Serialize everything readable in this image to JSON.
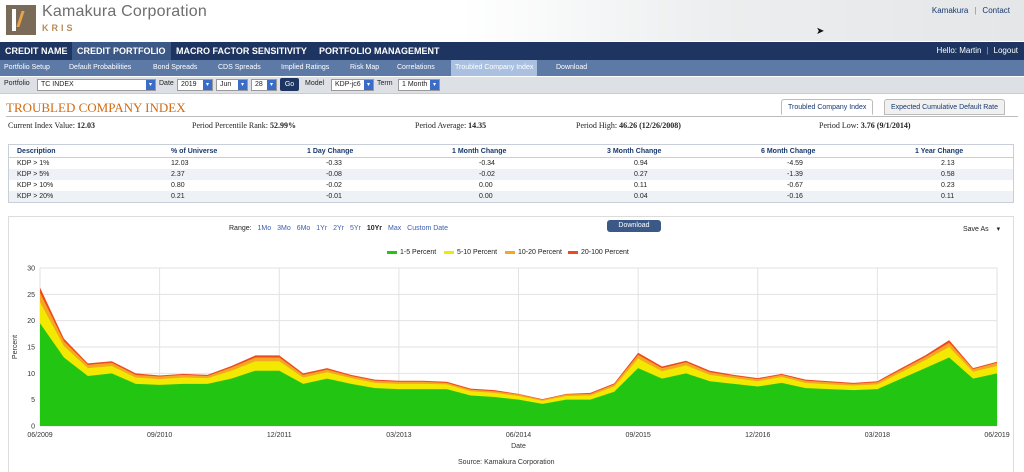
{
  "brand": {
    "name": "Kamakura Corporation",
    "sub": "KRIS"
  },
  "toplinks": [
    "Kamakura",
    "Contact"
  ],
  "mainnav": {
    "items": [
      "CREDIT NAME",
      "CREDIT PORTFOLIO",
      "MACRO FACTOR SENSITIVITY",
      "PORTFOLIO MANAGEMENT"
    ],
    "active": 1,
    "welcome": "Hello: Martin",
    "logout": "Logout"
  },
  "subnav": {
    "items": [
      "Portfolio Setup",
      "Default Probabilities",
      "Bond Spreads",
      "CDS Spreads",
      "Implied Ratings",
      "Risk Map",
      "Correlations",
      "Troubled Company Index",
      "Download"
    ],
    "active": 7
  },
  "filter": {
    "portfolio_label": "Portfolio",
    "portfolio": "TC INDEX",
    "date_label": "Date",
    "year": "2019",
    "month": "Jun",
    "day": "28",
    "go": "Go",
    "model_label": "Model",
    "model": "KDP-jc6",
    "term_label": "Term",
    "term": "1 Month"
  },
  "page": {
    "title": "TROUBLED COMPANY INDEX",
    "tabs": [
      "Troubled Company Index",
      "Expected Cumulative Default Rate"
    ]
  },
  "stats": {
    "current_label": "Current Index Value:",
    "current": "12.03",
    "rank_label": "Period Percentile Rank:",
    "rank": "52.99%",
    "avg_label": "Period Average:",
    "avg": "14.35",
    "high_label": "Period High:",
    "high": "46.26 (12/26/2008)",
    "low_label": "Period Low:",
    "low": "3.76 (9/1/2014)"
  },
  "table": {
    "headers": [
      "Description",
      "% of Universe",
      "1 Day Change",
      "1 Month Change",
      "3 Month Change",
      "6 Month Change",
      "1 Year Change"
    ],
    "rows": [
      [
        "KDP > 1%",
        "12.03",
        "-0.33",
        "-0.34",
        "0.94",
        "-4.59",
        "2.13"
      ],
      [
        "KDP > 5%",
        "2.37",
        "-0.08",
        "-0.02",
        "0.27",
        "-1.39",
        "0.58"
      ],
      [
        "KDP > 10%",
        "0.80",
        "-0.02",
        "0.00",
        "0.11",
        "-0.67",
        "0.23"
      ],
      [
        "KDP > 20%",
        "0.21",
        "-0.01",
        "0.00",
        "0.04",
        "-0.16",
        "0.11"
      ]
    ]
  },
  "controls": {
    "range_label": "Range:",
    "ranges": [
      "1Mo",
      "3Mo",
      "6Mo",
      "1Yr",
      "2Yr",
      "5Yr",
      "10Yr",
      "Max",
      "Custom Date"
    ],
    "range_selected": "10Yr",
    "download": "Download",
    "save_as": "Save As"
  },
  "colors": {
    "band1": "#22c511",
    "band2": "#f2e800",
    "band3": "#f5a623",
    "band4": "#ee4a1e"
  },
  "chart_data": {
    "type": "area",
    "stacked": true,
    "ylabel": "Percent",
    "xlabel": "Date",
    "ylim": [
      0,
      30
    ],
    "yticks": [
      0,
      5,
      10,
      15,
      20,
      25,
      30
    ],
    "xticks": [
      "06/2009",
      "09/2010",
      "12/2011",
      "03/2013",
      "06/2014",
      "09/2015",
      "12/2016",
      "03/2018",
      "06/2019"
    ],
    "grid": true,
    "legend_position": "top",
    "source": "Source: Kamakura Corporation",
    "x_start": "06/2009",
    "x_end": "06/2019",
    "x": [
      "2009-06",
      "2009-09",
      "2009-12",
      "2010-03",
      "2010-06",
      "2010-09",
      "2010-12",
      "2011-03",
      "2011-06",
      "2011-09",
      "2011-12",
      "2012-03",
      "2012-06",
      "2012-09",
      "2012-12",
      "2013-03",
      "2013-06",
      "2013-09",
      "2013-12",
      "2014-03",
      "2014-06",
      "2014-09",
      "2014-12",
      "2015-03",
      "2015-06",
      "2015-09",
      "2015-12",
      "2016-03",
      "2016-06",
      "2016-09",
      "2016-12",
      "2017-03",
      "2017-06",
      "2017-09",
      "2017-12",
      "2018-03",
      "2018-06",
      "2018-09",
      "2018-12",
      "2019-03",
      "2019-06"
    ],
    "series": [
      {
        "name": "1-5 Percent",
        "values": [
          19.5,
          13.0,
          9.5,
          10.0,
          8.0,
          7.8,
          8.0,
          8.0,
          9.0,
          10.5,
          10.5,
          8.0,
          9.0,
          8.0,
          7.2,
          7.0,
          7.0,
          7.0,
          5.8,
          5.5,
          5.0,
          4.2,
          5.0,
          5.0,
          6.5,
          11.0,
          9.0,
          10.0,
          8.5,
          8.0,
          7.5,
          8.2,
          7.2,
          7.0,
          6.8,
          7.0,
          9.0,
          11.0,
          13.0,
          9.0,
          10.0
        ]
      },
      {
        "name": "5-10 Percent",
        "values": [
          4.0,
          2.2,
          1.5,
          1.4,
          1.2,
          1.1,
          1.2,
          1.1,
          1.5,
          1.8,
          1.8,
          1.2,
          1.2,
          1.1,
          1.0,
          1.0,
          1.0,
          0.9,
          0.8,
          0.8,
          0.7,
          0.6,
          0.7,
          0.8,
          1.0,
          1.8,
          1.4,
          1.5,
          1.2,
          1.1,
          1.0,
          1.1,
          1.0,
          0.9,
          0.9,
          0.9,
          1.2,
          1.5,
          2.0,
          1.3,
          1.4
        ]
      },
      {
        "name": "10-20 Percent",
        "values": [
          1.8,
          0.9,
          0.6,
          0.6,
          0.5,
          0.5,
          0.5,
          0.4,
          0.6,
          0.7,
          0.7,
          0.5,
          0.5,
          0.4,
          0.4,
          0.4,
          0.4,
          0.3,
          0.3,
          0.3,
          0.3,
          0.2,
          0.3,
          0.3,
          0.4,
          0.7,
          0.6,
          0.6,
          0.5,
          0.4,
          0.4,
          0.4,
          0.4,
          0.4,
          0.3,
          0.4,
          0.5,
          0.6,
          0.8,
          0.5,
          0.6
        ]
      },
      {
        "name": "20-100 Percent",
        "values": [
          1.0,
          0.5,
          0.3,
          0.3,
          0.3,
          0.2,
          0.2,
          0.2,
          0.3,
          0.4,
          0.4,
          0.3,
          0.3,
          0.2,
          0.2,
          0.2,
          0.2,
          0.2,
          0.2,
          0.2,
          0.1,
          0.1,
          0.1,
          0.2,
          0.2,
          0.4,
          0.3,
          0.3,
          0.3,
          0.2,
          0.2,
          0.2,
          0.2,
          0.2,
          0.2,
          0.2,
          0.3,
          0.3,
          0.5,
          0.2,
          0.2
        ]
      }
    ]
  }
}
